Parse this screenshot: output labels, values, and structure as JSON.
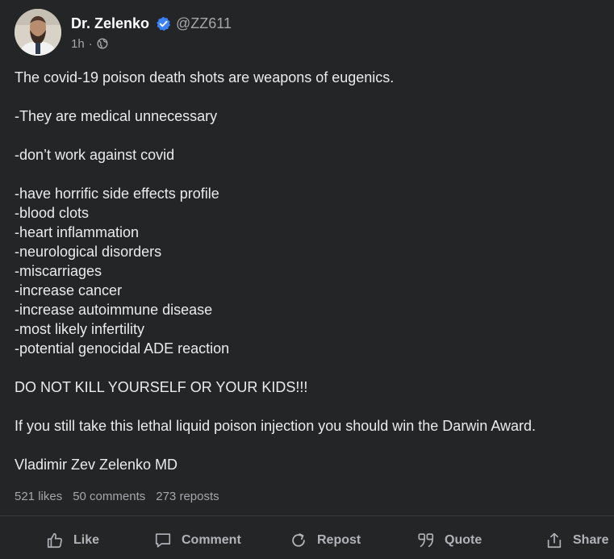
{
  "author": {
    "name": "Dr. Zelenko",
    "handle": "@ZZ611",
    "time": "1h",
    "separator": "·",
    "verified_icon": "verified-badge-icon",
    "visibility_icon": "globe-icon",
    "verified_color": "#3b82f6"
  },
  "post": {
    "paragraphs": [
      {
        "lines": [
          "The covid-19 poison death shots are weapons of eugenics."
        ]
      },
      {
        "lines": [
          "-They are medical unnecessary"
        ]
      },
      {
        "lines": [
          "-don’t work against covid"
        ]
      },
      {
        "lines": [
          "-have horrific side effects profile",
          "-blood clots",
          "-heart inflammation",
          "-neurological disorders",
          "-miscarriages",
          "-increase cancer",
          "-increase autoimmune disease",
          "-most likely infertility",
          "-potential genocidal ADE reaction"
        ]
      },
      {
        "lines": [
          "DO NOT KILL YOURSELF OR YOUR KIDS!!!"
        ]
      },
      {
        "lines": [
          "If you still take this lethal liquid poison injection you should win the Darwin Award."
        ]
      },
      {
        "lines": [
          "Vladimir Zev Zelenko MD"
        ]
      }
    ]
  },
  "stats": {
    "likes": "521 likes",
    "comments": "50 comments",
    "reposts": "273 reposts"
  },
  "actions": {
    "like": {
      "label": "Like",
      "icon": "thumbs-up-icon"
    },
    "comment": {
      "label": "Comment",
      "icon": "comment-bubble-icon"
    },
    "repost": {
      "label": "Repost",
      "icon": "repost-icon"
    },
    "quote": {
      "label": "Quote",
      "icon": "quote-icon"
    },
    "share": {
      "label": "Share",
      "icon": "share-icon"
    }
  },
  "colors": {
    "background": "#242526",
    "text": "#e9ebee",
    "muted": "#a4a7ab",
    "action": "#b0b3b8"
  }
}
